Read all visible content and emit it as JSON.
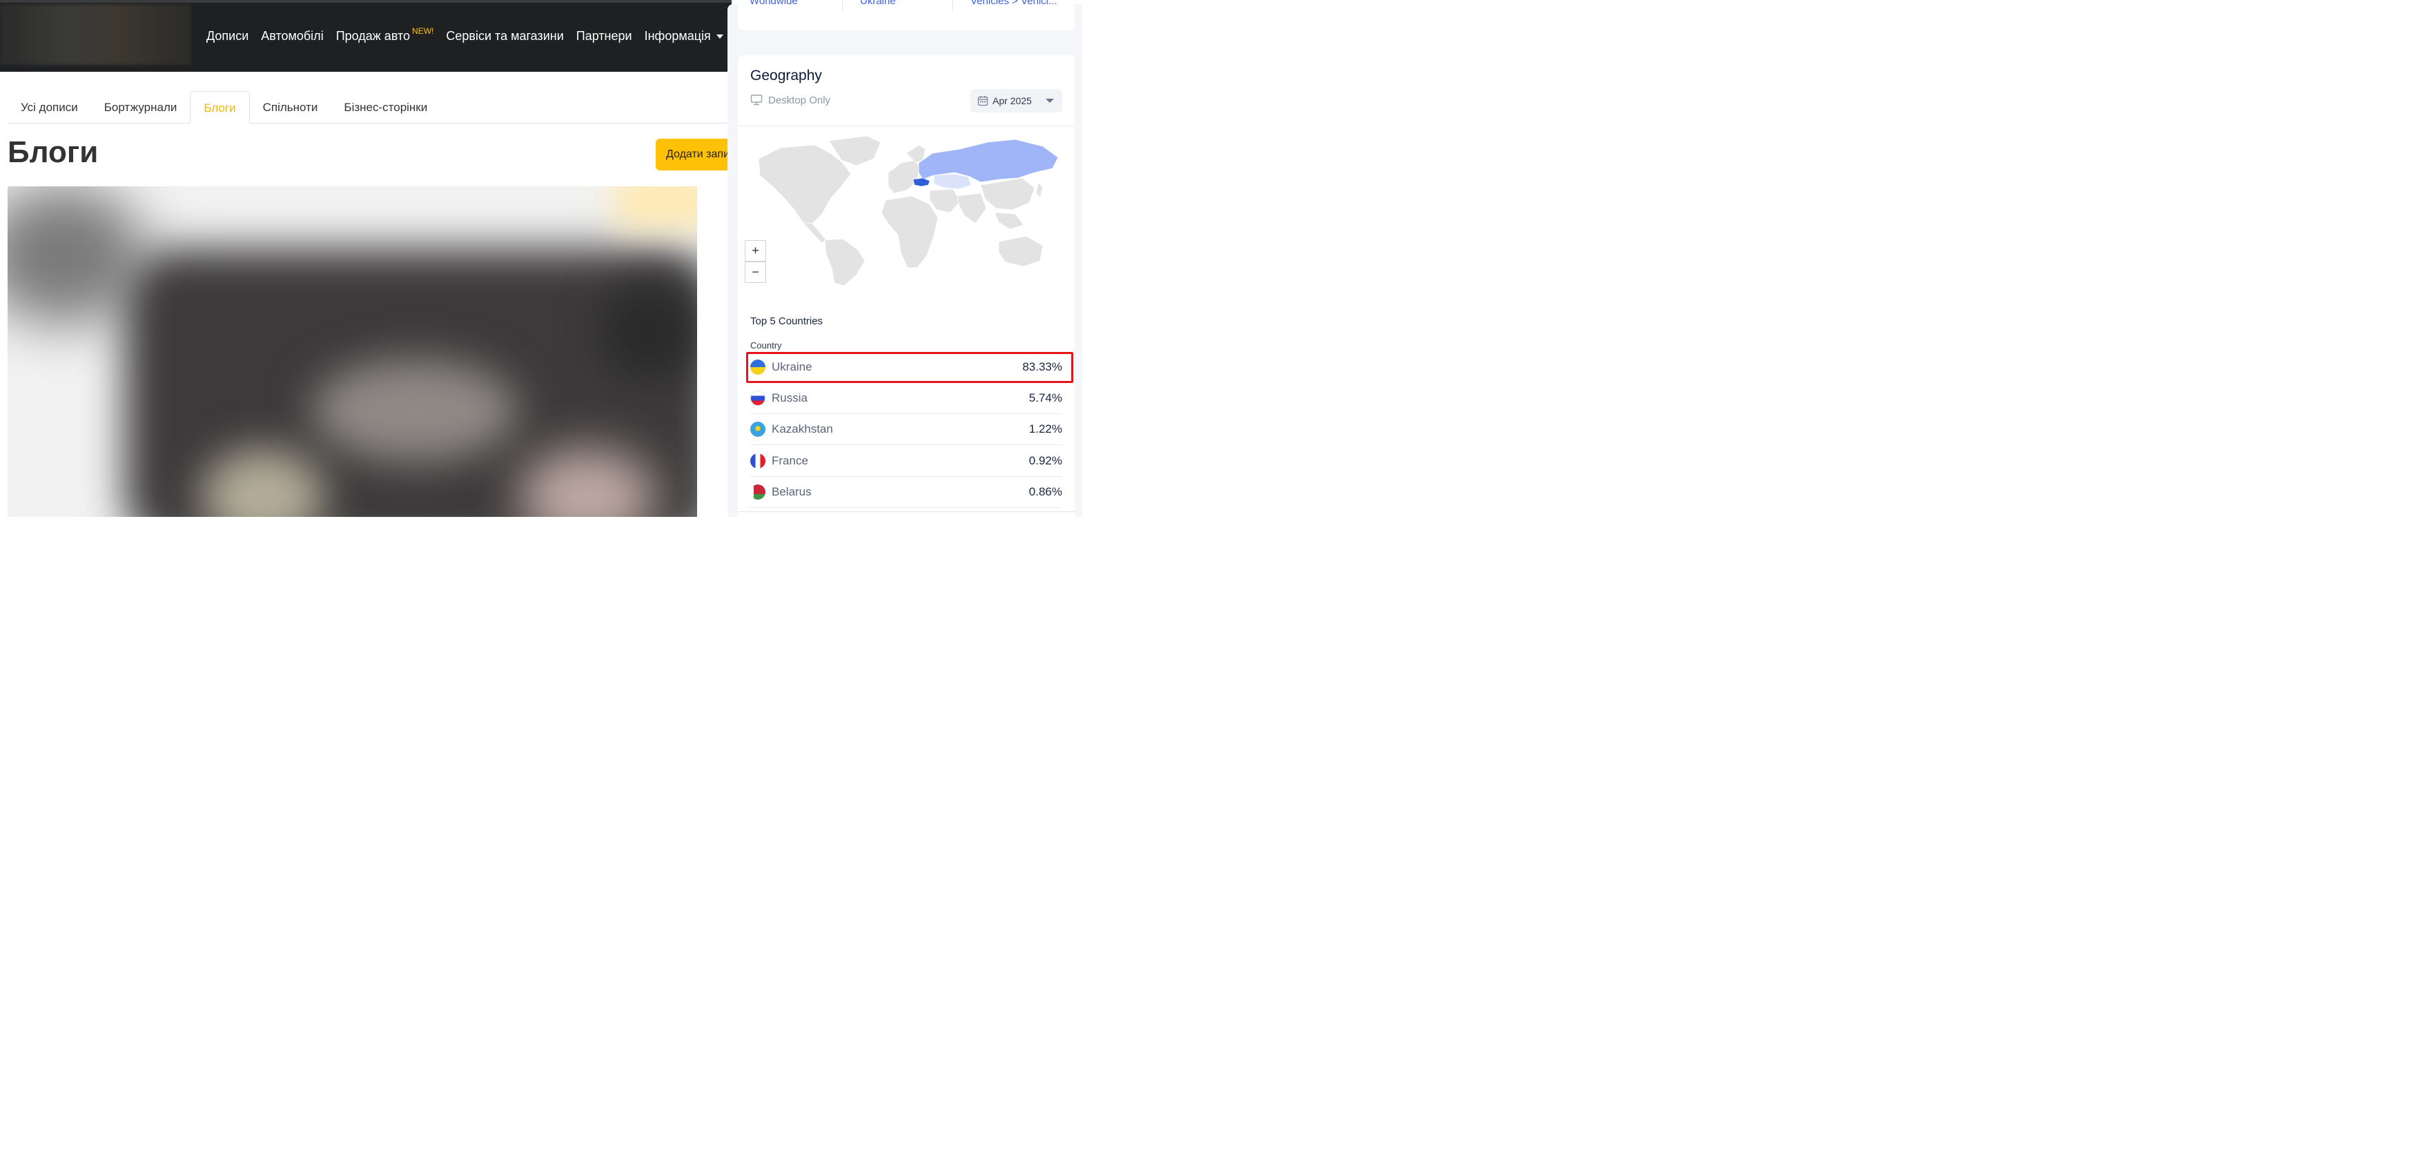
{
  "site": {
    "nav": [
      {
        "label": "Дописи"
      },
      {
        "label": "Автомобілі"
      },
      {
        "label": "Продаж авто",
        "badge": "NEW!"
      },
      {
        "label": "Сервіси та магазини"
      },
      {
        "label": "Партнери"
      },
      {
        "label": "Інформація",
        "dropdown": true
      }
    ],
    "tabs": [
      {
        "label": "Усі дописи",
        "active": false
      },
      {
        "label": "Бортжурнали",
        "active": false
      },
      {
        "label": "Блоги",
        "active": true
      },
      {
        "label": "Спільноти",
        "active": false
      },
      {
        "label": "Бізнес-сторінки",
        "active": false
      }
    ],
    "page_title": "Блоги",
    "add_button": "Додати запис",
    "colors": {
      "topbar": "#1e2022",
      "accent": "#ffc107",
      "active_tab": "#f2b705"
    }
  },
  "panel": {
    "breadcrumb": [
      "Worldwide",
      "Ukraine",
      "Vehicles > Vehicl..."
    ],
    "geography": {
      "title": "Geography",
      "device": "Desktop Only",
      "date": "Apr 2025",
      "zoom_in": "+",
      "zoom_out": "−",
      "top_title": "Top 5 Countries",
      "column": "Country",
      "countries": [
        {
          "name": "Ukraine",
          "share": "83.33%",
          "flag": "flag-ukraine",
          "highlighted": true
        },
        {
          "name": "Russia",
          "share": "5.74%",
          "flag": "flag-russia",
          "highlighted": false
        },
        {
          "name": "Kazakhstan",
          "share": "1.22%",
          "flag": "flag-kazakhstan",
          "highlighted": false
        },
        {
          "name": "France",
          "share": "0.92%",
          "flag": "flag-france",
          "highlighted": false
        },
        {
          "name": "Belarus",
          "share": "0.86%",
          "flag": "flag-belarus",
          "highlighted": false
        }
      ],
      "colors": {
        "ukraine": "#2f5fd6",
        "russia": "#9fb5f7",
        "kazakhstan": "#dbe3fb",
        "land": "#e3e3e3",
        "highlight": "#e8141a"
      }
    }
  }
}
